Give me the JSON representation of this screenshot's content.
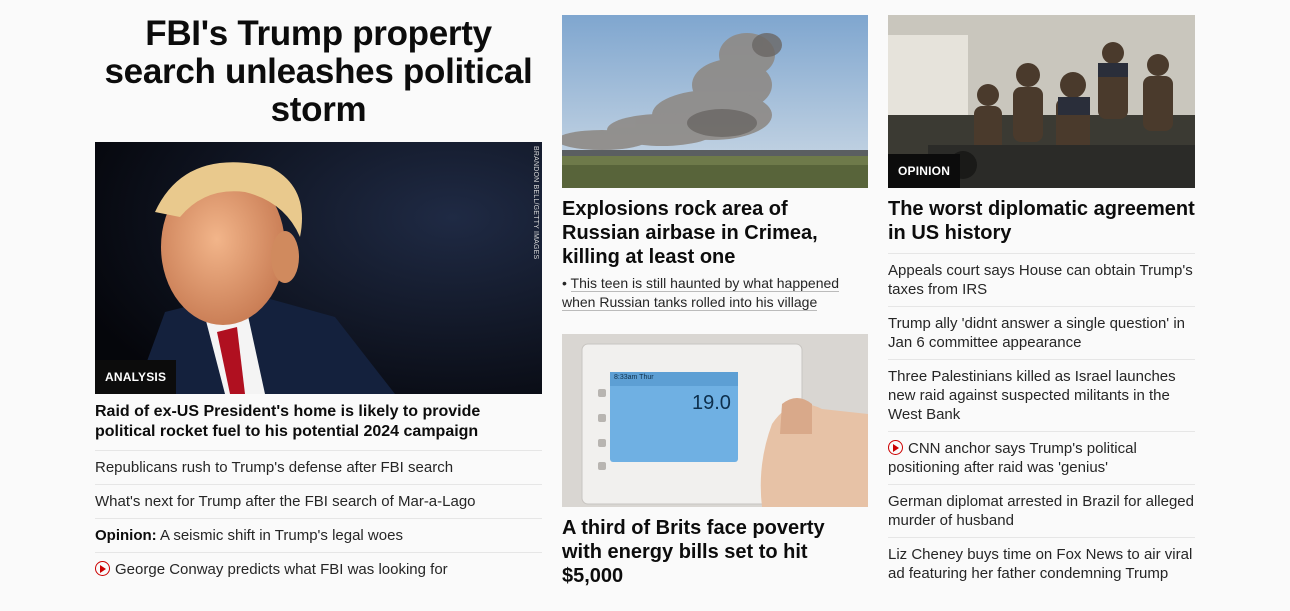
{
  "main": {
    "headline": "FBI's Trump property search unleashes political storm",
    "image_label": "ANALYSIS",
    "image_credit": "BRANDON BELL/GETTY IMAGES",
    "lead_title": "Raid of ex-US President's home is likely to provide political rocket fuel to his potential 2024 campaign",
    "links": [
      "Republicans rush to Trump's defense after FBI search",
      "What's next for Trump after the FBI search of Mar-a-Lago"
    ],
    "opinion_prefix": "Opinion:",
    "opinion_text": " A seismic shift in Trump's legal woes",
    "video_link": "George Conway predicts what FBI was looking for"
  },
  "middle": {
    "crimea_title": "Explosions rock area of Russian airbase in Crimea, killing at least one",
    "crimea_sub": "This teen is still haunted by what happened when Russian tanks rolled into his village",
    "energy_title": "A third of Brits face poverty with energy bills set to hit $5,000",
    "thermostat_time": "8:33am Thur",
    "thermostat_temp": "19.0"
  },
  "right": {
    "image_label": "OPINION",
    "title": "The worst diplomatic agreement in US history",
    "links": [
      {
        "text": "Appeals court says House can obtain Trump's taxes from IRS",
        "video": false
      },
      {
        "text": "Trump ally 'didnt answer a single question' in Jan 6 committee appearance",
        "video": false
      },
      {
        "text": "Three Palestinians killed as Israel launches new raid against suspected militants in the West Bank",
        "video": false
      },
      {
        "text": "CNN anchor says Trump's political positioning after raid was 'genius'",
        "video": true
      },
      {
        "text": "German diplomat arrested in Brazil for alleged murder of husband",
        "video": false
      },
      {
        "text": "Liz Cheney buys time on Fox News to air viral ad featuring her father condemning Trump",
        "video": false
      }
    ]
  },
  "colors": {
    "video_red": "#cc0000",
    "label_bg": "#0c0c0c"
  }
}
